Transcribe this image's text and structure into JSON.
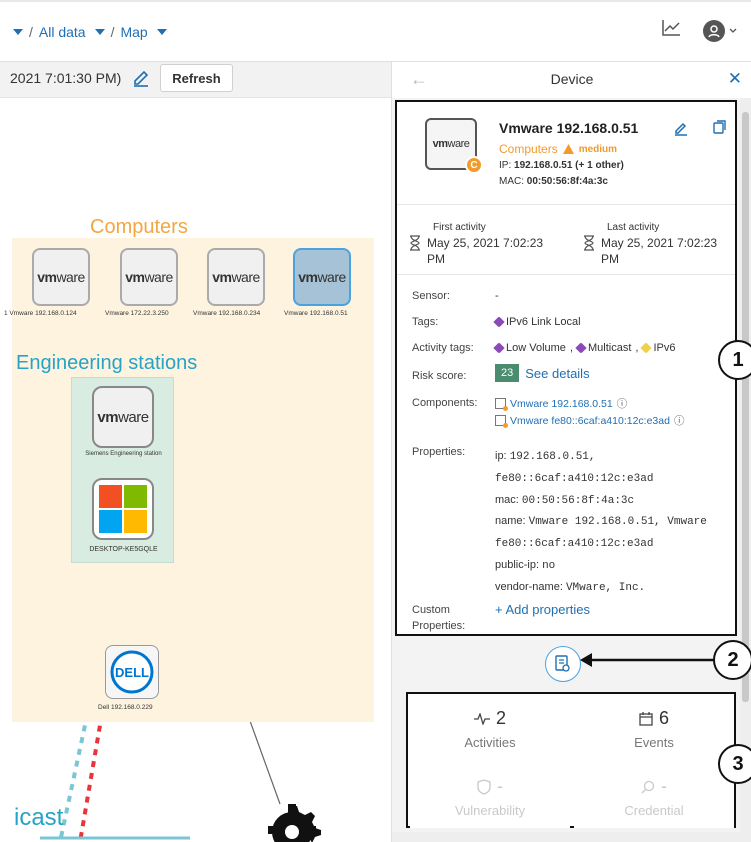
{
  "breadcrumb": {
    "item1": "All data",
    "item2": "Map"
  },
  "toolbar": {
    "timestamp": "2021 7:01:30 PM)",
    "refresh_label": "Refresh"
  },
  "map": {
    "computers_title": "Computers",
    "computers": [
      {
        "label": "1 Vmware 192.168.0.124"
      },
      {
        "label": "Vmware 172.22.3.250"
      },
      {
        "label": "Vmware 192.168.0.234"
      },
      {
        "label": "Vmware 192.168.0.51"
      }
    ],
    "engineering_title": "Engineering stations",
    "engineering": [
      {
        "label": "Siemens Engineering station"
      },
      {
        "label": "DESKTOP-KE5GQLE"
      }
    ],
    "dell_label": "Dell 192.168.0.229",
    "dell_logo": "DELL",
    "bottom_word": "icast",
    "vm_logo_a": "vm",
    "vm_logo_b": "ware"
  },
  "panel": {
    "title": "Device",
    "device_name": "Vmware 192.168.0.51",
    "category": "Computers",
    "risk_level": "medium",
    "badge": "C",
    "ip_prefix": "IP: ",
    "ip_value": "192.168.0.51 (+ 1 other)",
    "mac_prefix": "MAC: ",
    "mac_value": "00:50:56:8f:4a:3c",
    "first_activity_label": "First activity",
    "first_activity_value": "May 25, 2021 7:02:23 PM",
    "last_activity_label": "Last activity",
    "last_activity_value": "May 25, 2021 7:02:23 PM",
    "sensor_label": "Sensor:",
    "sensor_value": "-",
    "tags_label": "Tags:",
    "tags": [
      "IPv6 Link Local"
    ],
    "activity_tags_label": "Activity tags:",
    "activity_tags": [
      "Low Volume",
      "Multicast",
      "IPv6"
    ],
    "risk_label": "Risk score:",
    "risk_score": "23",
    "risk_link": "See details",
    "components_label": "Components:",
    "components": [
      "Vmware 192.168.0.51",
      "Vmware fe80::6caf:a410:12c:e3ad"
    ],
    "properties_label": "Properties:",
    "properties": [
      {
        "k": "ip: ",
        "v": "192.168.0.51,"
      },
      {
        "k": "",
        "v": "fe80::6caf:a410:12c:e3ad"
      },
      {
        "k": "mac: ",
        "v": "00:50:56:8f:4a:3c"
      },
      {
        "k": "name: ",
        "v": "Vmware 192.168.0.51, Vmware"
      },
      {
        "k": "",
        "v": "fe80::6caf:a410:12c:e3ad"
      },
      {
        "k": "public-ip: ",
        "v": "no"
      },
      {
        "k": "vendor-name: ",
        "v": "VMware, Inc."
      }
    ],
    "custom_label_1": "Custom",
    "custom_label_2": "Properties:",
    "add_properties": "+ Add properties"
  },
  "stats": [
    {
      "value": "2",
      "label": "Activities",
      "icon": "activity-icon"
    },
    {
      "value": "6",
      "label": "Events",
      "icon": "calendar-icon"
    },
    {
      "value": "-",
      "label": "Vulnerability",
      "icon": "shield-icon"
    },
    {
      "value": "-",
      "label": "Credential",
      "icon": "search-icon"
    }
  ],
  "callouts": [
    "1",
    "2",
    "3"
  ],
  "colors": {
    "accent": "#1f6fb4",
    "orange": "#f39a2d",
    "risk_green": "#4a8d6e",
    "cyan": "#27a3c7"
  }
}
